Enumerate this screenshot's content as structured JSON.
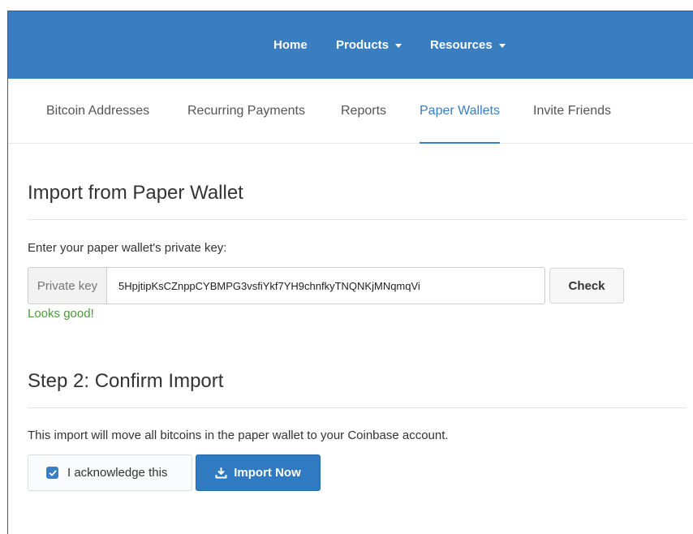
{
  "topnav": {
    "home": "Home",
    "products": "Products",
    "resources": "Resources"
  },
  "subnav": {
    "tabs": [
      {
        "label": "Bitcoin Addresses"
      },
      {
        "label": "Recurring Payments"
      },
      {
        "label": "Reports"
      },
      {
        "label": "Paper Wallets"
      },
      {
        "label": "Invite Friends"
      }
    ],
    "active": "Paper Wallets"
  },
  "import_section": {
    "title": "Import from Paper Wallet",
    "prompt": "Enter your paper wallet's private key:",
    "addon_label": "Private key",
    "key_value": "5HpjtipKsCZnppCYBMPG3vsfiYkf7YH9chnfkyTNQNKjMNqmqVi",
    "check_label": "Check",
    "validation_message": "Looks good!"
  },
  "confirm_section": {
    "title": "Step 2: Confirm Import",
    "description": "This import will move all bitcoins in the paper wallet to your Coinbase account.",
    "acknowledge_label": "I acknowledge this",
    "acknowledge_checked": true,
    "import_label": "Import Now"
  },
  "colors": {
    "brand_blue": "#3a7ec2",
    "success_green": "#4a9a3b"
  },
  "icons": {
    "checkbox": "checkmark-icon",
    "import": "download-tray-icon",
    "dropdown": "caret-down-icon"
  }
}
